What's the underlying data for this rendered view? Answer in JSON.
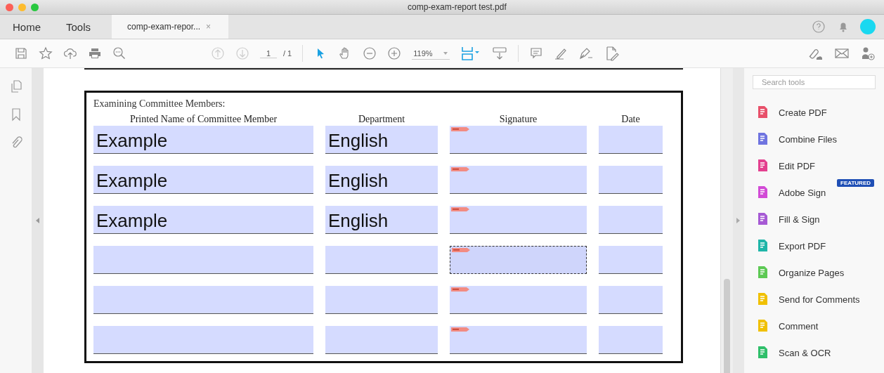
{
  "window": {
    "title": "comp-exam-report test.pdf"
  },
  "tabs": [
    {
      "label": "Home",
      "selected": false
    },
    {
      "label": "Tools",
      "selected": false
    },
    {
      "label": "comp-exam-repor...",
      "selected": true,
      "close": "×"
    }
  ],
  "toolbar": {
    "page_current": "1",
    "page_total": "/ 1",
    "zoom": "119%"
  },
  "form": {
    "heading": "Examining Committee Members:",
    "columns": [
      "Printed Name of Committee Member",
      "Department",
      "Signature",
      "Date"
    ],
    "rows": [
      {
        "name": "Example",
        "department": "English",
        "signature_focused": false
      },
      {
        "name": "Example",
        "department": "English",
        "signature_focused": false
      },
      {
        "name": "Example",
        "department": "English",
        "signature_focused": false
      },
      {
        "name": "",
        "department": "",
        "signature_focused": true
      },
      {
        "name": "",
        "department": "",
        "signature_focused": false
      },
      {
        "name": "",
        "department": "",
        "signature_focused": false
      }
    ]
  },
  "tools_panel": {
    "search": {
      "placeholder": "Search tools"
    },
    "items": [
      {
        "label": "Create PDF",
        "color": "#e8506a"
      },
      {
        "label": "Combine Files",
        "color": "#6f74e0"
      },
      {
        "label": "Edit PDF",
        "color": "#e3408f"
      },
      {
        "label": "Adobe Sign",
        "color": "#d24bd6",
        "badge": "FEATURED"
      },
      {
        "label": "Fill & Sign",
        "color": "#a65ad4"
      },
      {
        "label": "Export PDF",
        "color": "#1fb5a8"
      },
      {
        "label": "Organize Pages",
        "color": "#5dc954"
      },
      {
        "label": "Send for Comments",
        "color": "#f0c000"
      },
      {
        "label": "Comment",
        "color": "#f0c000"
      },
      {
        "label": "Scan & OCR",
        "color": "#2fbf6a"
      }
    ]
  }
}
